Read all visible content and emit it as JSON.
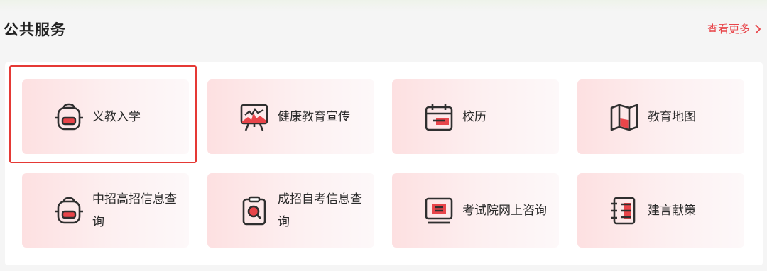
{
  "section": {
    "title": "公共服务",
    "more_label": "查看更多"
  },
  "services": [
    {
      "label": "义教入学",
      "icon": "backpack-icon"
    },
    {
      "label": "健康教育宣传",
      "icon": "presentation-board-icon"
    },
    {
      "label": "校历",
      "icon": "calendar-icon"
    },
    {
      "label": "教育地图",
      "icon": "map-icon"
    },
    {
      "label": "中招高招信息查询",
      "icon": "backpack-icon"
    },
    {
      "label": "成招自考信息查询",
      "icon": "clipboard-search-icon"
    },
    {
      "label": "考试院网上咨询",
      "icon": "monitor-icon"
    },
    {
      "label": "建言献策",
      "icon": "notebook-icon"
    }
  ],
  "colors": {
    "accent": "#e8454a",
    "highlight_border": "#e53935",
    "card_gradient_start": "#fde0e1"
  }
}
